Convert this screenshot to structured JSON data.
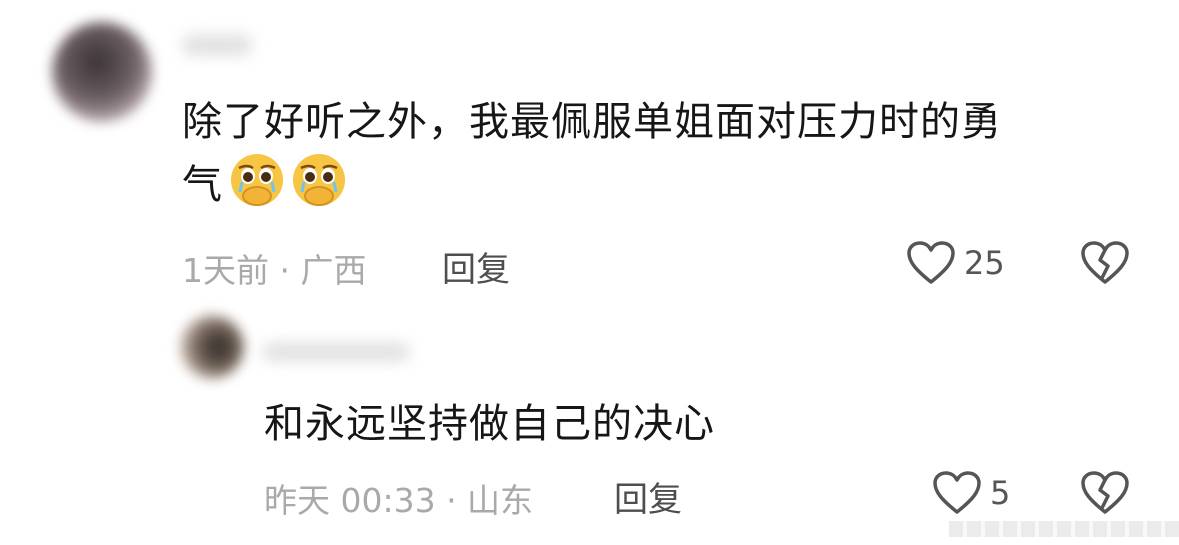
{
  "comment": {
    "text_line1": "除了好听之外，我最佩服单姐面对压力时的勇",
    "text_line2": "气",
    "emoji": [
      "pleading-face-hands-emoji",
      "pleading-face-hands-emoji"
    ],
    "meta": "1天前 · 广西",
    "reply_label": "回复",
    "likes": "25",
    "icons": {
      "like": "heart-outline-icon",
      "dislike": "broken-heart-icon"
    }
  },
  "reply": {
    "text": "和永远坚持做自己的决心",
    "meta": "昨天 00:33 · 山东",
    "reply_label": "回复",
    "likes": "5",
    "icons": {
      "like": "heart-outline-icon",
      "dislike": "broken-heart-icon"
    }
  },
  "colors": {
    "meta": "#a9a9a9",
    "icon": "#555555",
    "text": "#161616"
  }
}
